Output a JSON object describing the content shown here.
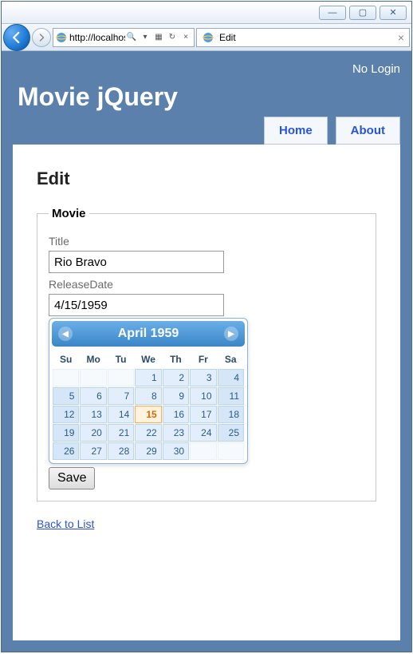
{
  "window": {
    "minimize": "—",
    "maximize": "▢",
    "close": "✕"
  },
  "browser": {
    "url": "http://localhost:",
    "search_glyph": "🔍",
    "tab_title": "Edit",
    "tab_close": "×"
  },
  "page": {
    "login_text": "No Login",
    "site_title": "Movie jQuery",
    "nav": {
      "home": "Home",
      "about": "About"
    },
    "heading": "Edit",
    "form": {
      "legend": "Movie",
      "title_label": "Title",
      "title_value": "Rio Bravo",
      "release_label": "ReleaseDate",
      "release_value": "4/15/1959",
      "save": "Save"
    },
    "back_link": "Back to List"
  },
  "datepicker": {
    "month_year": "April 1959",
    "prev": "◀",
    "next": "▶",
    "day_headers": [
      "Su",
      "Mo",
      "Tu",
      "We",
      "Th",
      "Fr",
      "Sa"
    ],
    "weeks": [
      [
        null,
        null,
        null,
        1,
        2,
        3,
        4
      ],
      [
        5,
        6,
        7,
        8,
        9,
        10,
        11
      ],
      [
        12,
        13,
        14,
        15,
        16,
        17,
        18
      ],
      [
        19,
        20,
        21,
        22,
        23,
        24,
        25
      ],
      [
        26,
        27,
        28,
        29,
        30,
        null,
        null
      ]
    ],
    "selected": 15
  }
}
